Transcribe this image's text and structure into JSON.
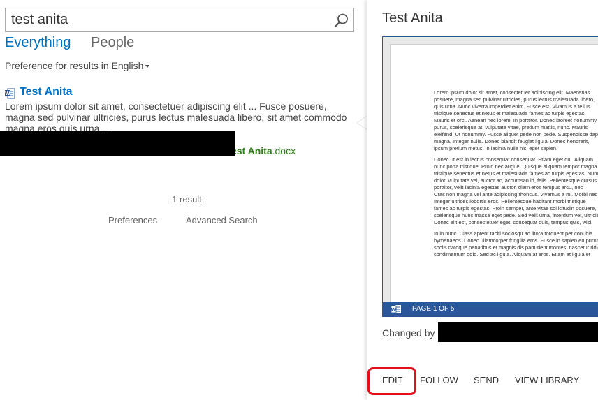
{
  "search": {
    "value": "test anita",
    "placeholder": ""
  },
  "nav": {
    "everything": "Everything",
    "people": "People"
  },
  "preference": {
    "label": "Preference for results in",
    "language": "English"
  },
  "result": {
    "title": "Test Anita",
    "snippet": "Lorem ipsum dolor sit amet, consectetuer adipiscing elit ... Fusce posuere, magna sed pulvinar ultricies, purus lectus malesuada libero, sit amet commodo magna eros quis urna ...",
    "url_bold": "est Anita",
    "url_ext": ".docx"
  },
  "results_count": "1 result",
  "footer": {
    "preferences": "Preferences",
    "advanced_search": "Advanced Search"
  },
  "preview": {
    "title": "Test Anita",
    "page_indicator": "PAGE 1 OF 5",
    "doc_paragraphs": [
      [
        "Lorem ipsum dolor sit amet, consectetuer adipiscing elit. Maecenas",
        "posuere, magna sed pulvinar ultricies, purus lectus malesuada libero,",
        "quis urna. Nunc viverra imperdiet enim. Fusce est. Vivamus a tellus.",
        "tristique senectus et netus et malesuada fames ac turpis egestas.",
        "Mauris et orci. Aenean nec lorem. In porttitor. Donec laoreet nonummy",
        "purus, scelerisque at, vulputate vitae, pretium mattis, nunc. Mauris",
        "eleifend. Ut nonummy. Fusce aliquet pede non pede. Suspendisse dapibus",
        "magna. Integer nulla. Donec blandit feugiat ligula. Donec hendrerit,",
        "ipsum pretium metus, in lacinia nulla nisl eget sapien."
      ],
      [
        "Donec ut est in lectus consequat consequat. Etiam eget dui. Aliquam",
        "nunc porta tristique. Proin nec augue. Quisque aliquam tempor magna.",
        "tristique senectus et netus et malesuada fames ac turpis egestas. Nunc",
        "dolor, vulputate vel, auctor ac, accumsan id, felis. Pellentesque cursus",
        "porttitor, velit lacinia egestas auctor, diam eros tempus arcu, nec",
        "Cras non magna vel ante adipiscing rhoncus. Vivamus a mi. Morbi neque.",
        "Integer ultrices lobortis eros. Pellentesque habitant morbi tristique",
        "fames ac turpis egestas. Proin semper, ante vitae sollicitudin posuere,",
        "scelerisque nunc massa eget pede. Sed velit urna, interdum vel, ultricies",
        "Donec elit est, consectetuer eget, consequat quis, tempus quis, wisi."
      ],
      [
        "In in nunc. Class aptent taciti sociosqu ad litora torquent per conubia",
        "hymenaeos. Donec ullamcorper fringilla eros. Fusce in sapien eu purus",
        "sociis natoque penatibus et magnis dis parturient montes, nascetur ridiculus",
        "condimentum odio. Sed ac ligula. Aliquam at eros. Etiam at ligula et"
      ]
    ]
  },
  "changed_by_label": "Changed by",
  "actions": {
    "edit": "EDIT",
    "follow": "FOLLOW",
    "send": "SEND",
    "view_library": "VIEW LIBRARY"
  },
  "colors": {
    "link_blue": "#0072c6",
    "url_green": "#2e7d16",
    "word_blue": "#2b579a",
    "highlight_red": "#e3101b"
  }
}
